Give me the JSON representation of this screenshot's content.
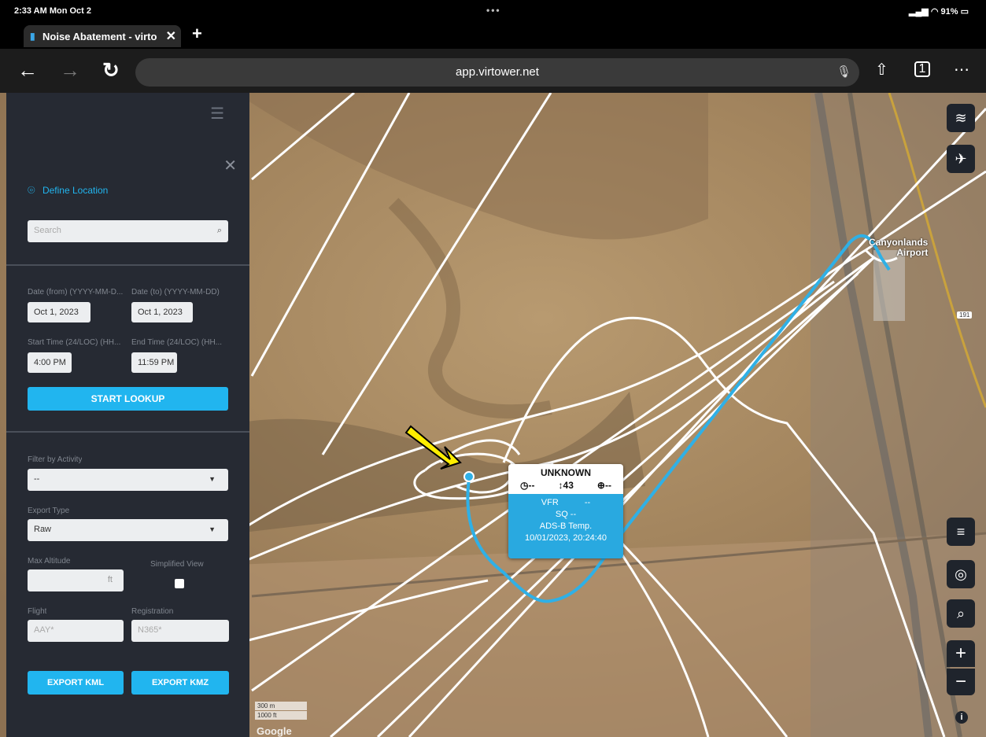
{
  "status": {
    "time": "2:33 AM  Mon Oct 2",
    "dots": "•••",
    "battery": "91%"
  },
  "browser": {
    "tab_title": "Noise Abatement - virto",
    "url": "app.virtower.net"
  },
  "sidebar": {
    "define_location": "Define Location",
    "search_placeholder": "Search",
    "date_from_label": "Date (from) (YYYY-MM-D...",
    "date_to_label": "Date (to) (YYYY-MM-DD)",
    "date_from": "Oct 1, 2023",
    "date_to": "Oct 1, 2023",
    "start_time_label": "Start Time (24/LOC) (HH...",
    "end_time_label": "End Time (24/LOC) (HH...",
    "start_time": "4:00 PM",
    "end_time": "11:59 PM",
    "start_lookup": "START LOOKUP",
    "filter_activity_label": "Filter by Activity",
    "filter_activity_value": "--",
    "export_type_label": "Export Type",
    "export_type_value": "Raw",
    "max_altitude_label": "Max Altitude",
    "max_altitude_unit": "ft",
    "simplified_view_label": "Simplified View",
    "flight_label": "Flight",
    "flight_placeholder": "AAY*",
    "registration_label": "Registration",
    "registration_placeholder": "N365*",
    "export_kml": "EXPORT KML",
    "export_kmz": "EXPORT KMZ"
  },
  "map": {
    "airport_name": "Canyonlands\nAirport",
    "road_label": "191",
    "scale_m": "300 m",
    "scale_ft": "1000 ft",
    "google": "Google",
    "info": "i"
  },
  "popup": {
    "callsign": "UNKNOWN",
    "speed": "--",
    "altitude": "43",
    "heading": "--",
    "flight_rules": "VFR",
    "flight_rules_value": "--",
    "squawk": "SQ --",
    "source": "ADS-B Temp.",
    "timestamp": "10/01/2023, 20:24:40"
  },
  "colors": {
    "accent": "#21b5ef",
    "track_blue": "#2fb0e6",
    "sidebar_bg": "#262a33",
    "arrow_yellow": "#ffee00"
  }
}
